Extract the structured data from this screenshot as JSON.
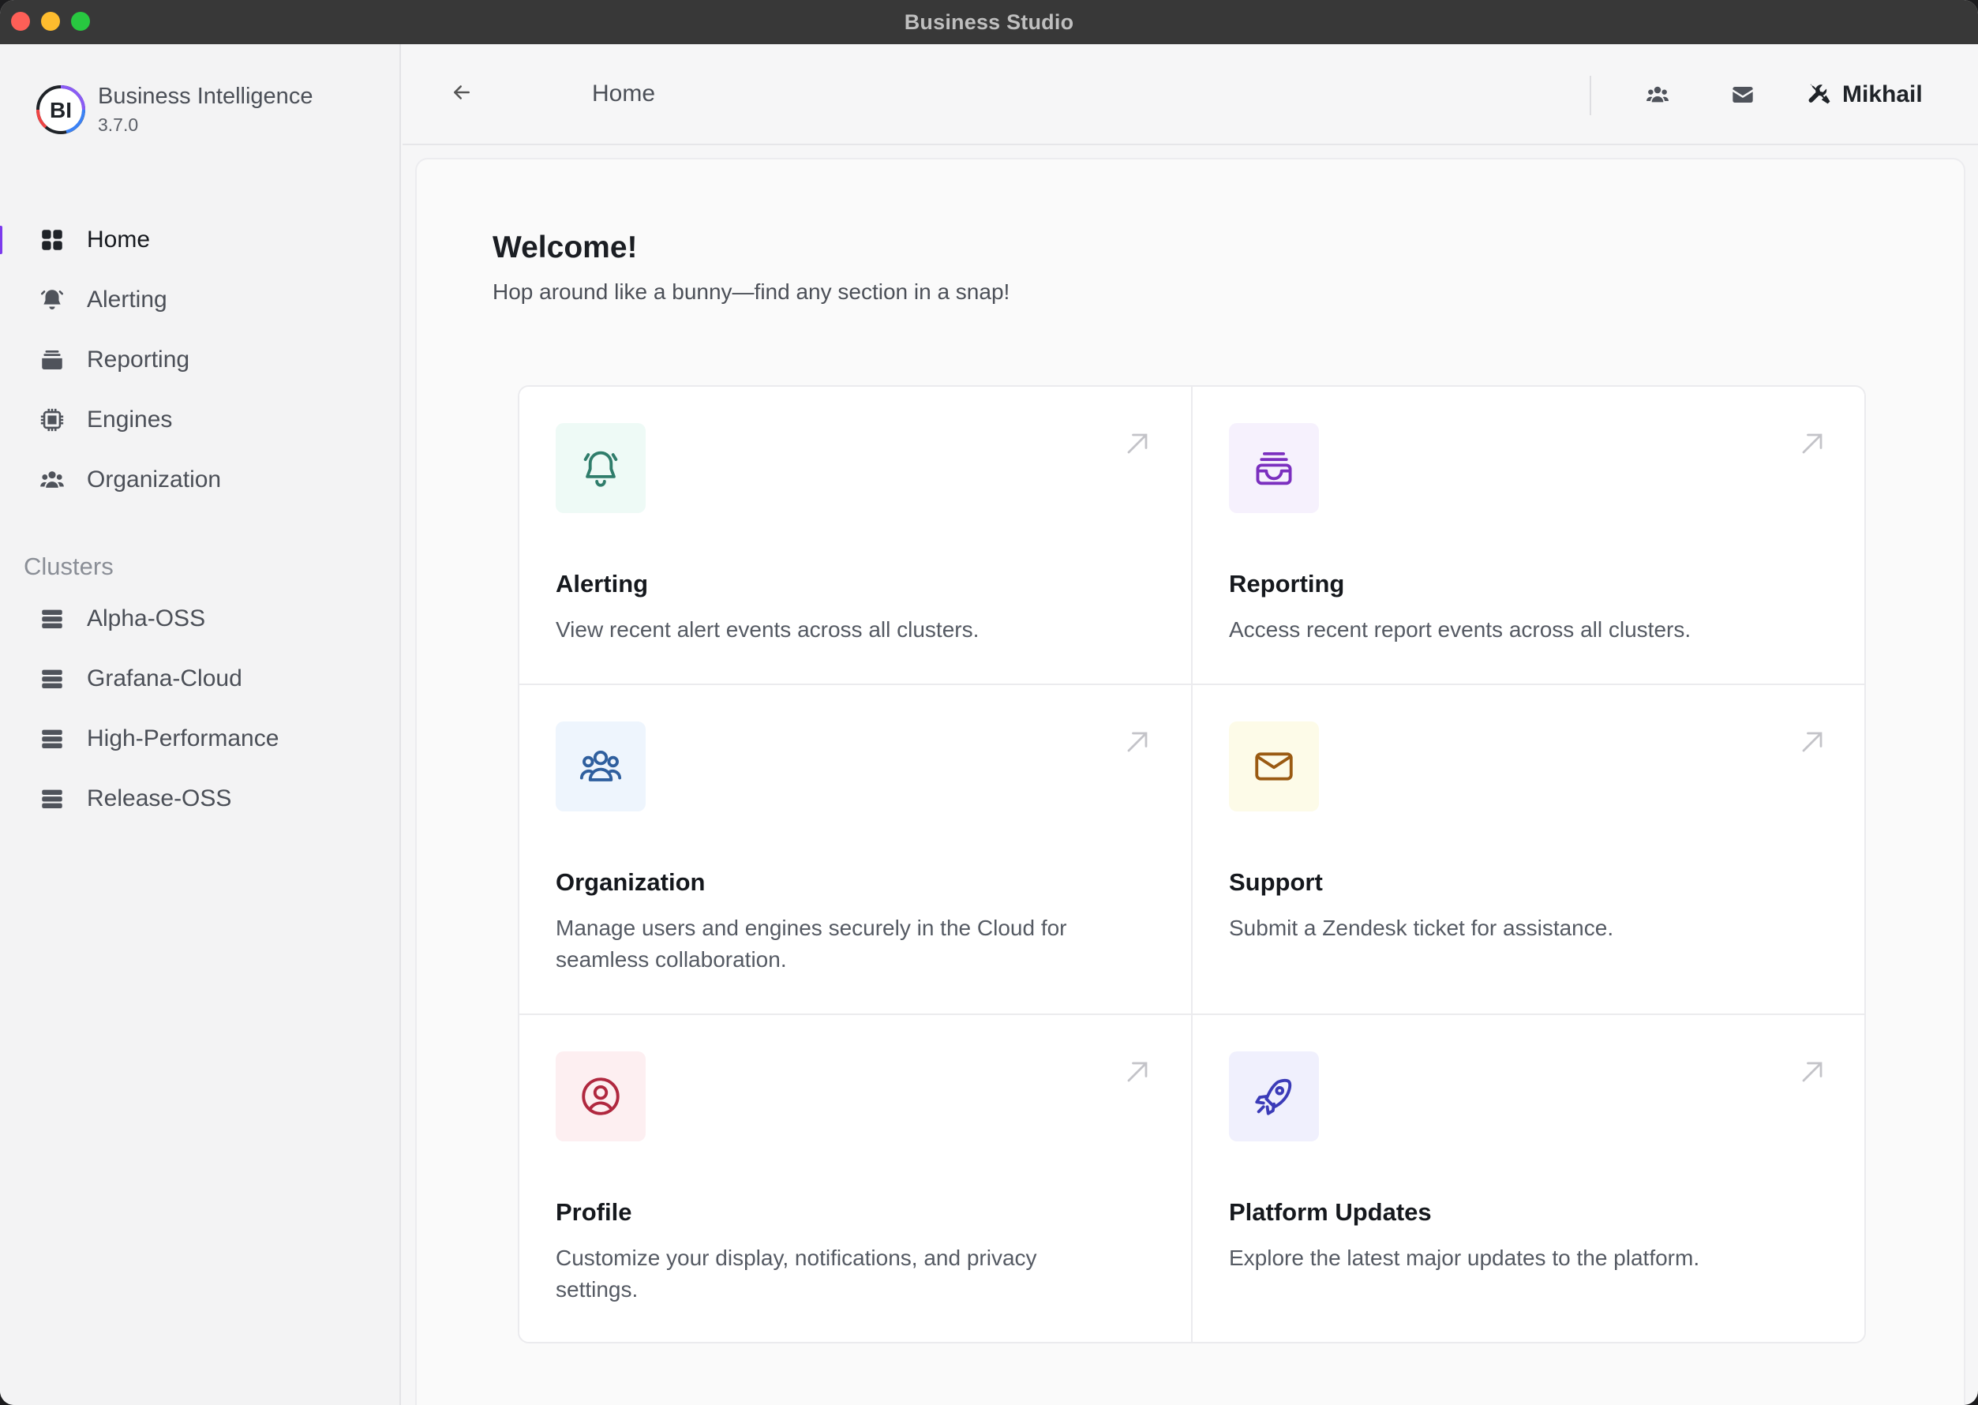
{
  "window": {
    "title": "Business Studio"
  },
  "brand": {
    "name": "Business Intelligence",
    "version": "3.7.0",
    "logo_text": "BI"
  },
  "sidebar": {
    "items": [
      {
        "label": "Home",
        "icon": "grid-icon",
        "active": true
      },
      {
        "label": "Alerting",
        "icon": "bell-icon"
      },
      {
        "label": "Reporting",
        "icon": "inbox-stack-icon"
      },
      {
        "label": "Engines",
        "icon": "cpu-chip-icon"
      },
      {
        "label": "Organization",
        "icon": "users-icon"
      }
    ],
    "clusters_heading": "Clusters",
    "clusters": [
      {
        "label": "Alpha-OSS",
        "icon": "server-stack-icon"
      },
      {
        "label": "Grafana-Cloud",
        "icon": "server-stack-icon"
      },
      {
        "label": "High-Performance",
        "icon": "server-stack-icon"
      },
      {
        "label": "Release-OSS",
        "icon": "server-stack-icon"
      }
    ]
  },
  "header": {
    "breadcrumb": "Home",
    "icons": [
      "back-arrow-icon",
      "users-icon",
      "envelope-icon",
      "wrench-screwdriver-icon"
    ],
    "user_name": "Mikhail"
  },
  "main": {
    "title": "Welcome!",
    "subtitle": "Hop around like a bunny—find any section in a snap!",
    "cards": [
      {
        "title": "Alerting",
        "description": "View recent alert events across all clusters.",
        "icon": "bell-icon",
        "icon_color": "#2f7d6b",
        "icon_bg": "#eefaf6"
      },
      {
        "title": "Reporting",
        "description": "Access recent report events across all clusters.",
        "icon": "inbox-stack-icon",
        "icon_color": "#7b2fbf",
        "icon_bg": "#f6f1fd"
      },
      {
        "title": "Organization",
        "description": "Manage users and engines securely in the Cloud for seamless collaboration.",
        "icon": "users-icon",
        "icon_color": "#2f5f9e",
        "icon_bg": "#eef5fd"
      },
      {
        "title": "Support",
        "description": "Submit a Zendesk ticket for assistance.",
        "icon": "envelope-icon",
        "icon_color": "#9a5a12",
        "icon_bg": "#fdfbe8"
      },
      {
        "title": "Profile",
        "description": "Customize your display, notifications, and privacy settings.",
        "icon": "user-circle-icon",
        "icon_color": "#b0283f",
        "icon_bg": "#fdeff1"
      },
      {
        "title": "Platform Updates",
        "description": "Explore the latest major updates to the platform.",
        "icon": "rocket-icon",
        "icon_color": "#3b3bb8",
        "icon_bg": "#f0f0fd"
      }
    ]
  },
  "colors": {
    "accent": "#7c3aed"
  }
}
